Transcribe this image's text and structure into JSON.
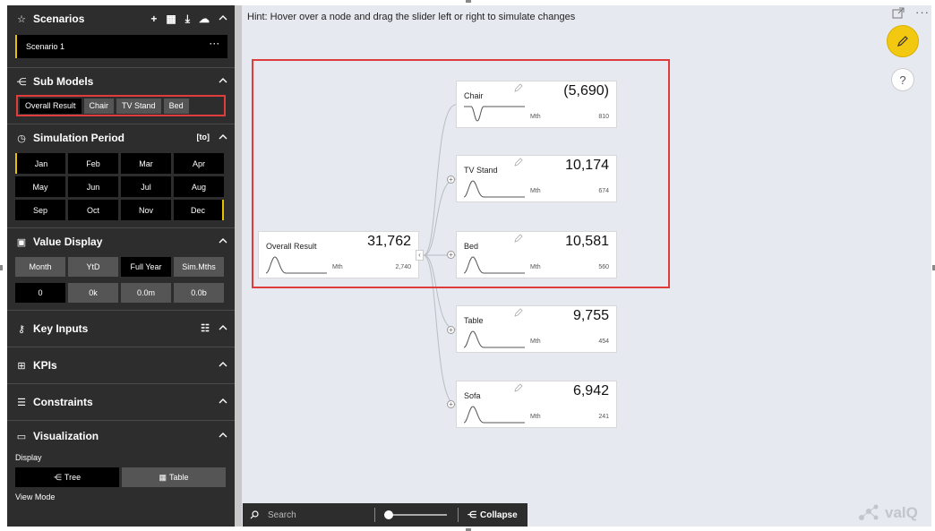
{
  "sidebar": {
    "scenarios": {
      "title": "Scenarios",
      "selected": "Scenario 1",
      "more": "···"
    },
    "submodels": {
      "title": "Sub Models",
      "tabs": [
        "Overall Result",
        "Chair",
        "TV Stand",
        "Bed"
      ],
      "active_index": 0
    },
    "simulation": {
      "title": "Simulation Period",
      "to_label": "[to]",
      "months": [
        "Jan",
        "Feb",
        "Mar",
        "Apr",
        "May",
        "Jun",
        "Jul",
        "Aug",
        "Sep",
        "Oct",
        "Nov",
        "Dec"
      ]
    },
    "value_display": {
      "title": "Value Display",
      "modes": [
        "Month",
        "YtD",
        "Full Year",
        "Sim.Mths"
      ],
      "active_mode": 2,
      "scales": [
        "0",
        "0k",
        "0.0m",
        "0.0b"
      ],
      "active_scale": 0
    },
    "key_inputs": {
      "title": "Key Inputs"
    },
    "kpis": {
      "title": "KPIs"
    },
    "constraints": {
      "title": "Constraints"
    },
    "visualization": {
      "title": "Visualization",
      "display_label": "Display",
      "tree_label": "Tree",
      "table_label": "Table",
      "view_mode_label": "View Mode"
    }
  },
  "canvas": {
    "hint": "Hint: Hover over a node and drag the slider left or right to simulate changes",
    "root": {
      "name": "Overall Result",
      "value": "31,762",
      "unit": "Mth",
      "small": "2,740"
    },
    "children": [
      {
        "name": "Chair",
        "value": "(5,690)",
        "unit": "Mth",
        "small": "810"
      },
      {
        "name": "TV Stand",
        "value": "10,174",
        "unit": "Mth",
        "small": "674"
      },
      {
        "name": "Bed",
        "value": "10,581",
        "unit": "Mth",
        "small": "560"
      },
      {
        "name": "Table",
        "value": "9,755",
        "unit": "Mth",
        "small": "454"
      },
      {
        "name": "Sofa",
        "value": "6,942",
        "unit": "Mth",
        "small": "241"
      }
    ]
  },
  "bottombar": {
    "search_placeholder": "Search",
    "collapse_label": "Collapse"
  },
  "brand": "valQ",
  "colors": {
    "accent_yellow": "#f2c811",
    "highlight_red": "#e03c3c",
    "sidebar_bg": "#2d2d2d"
  }
}
